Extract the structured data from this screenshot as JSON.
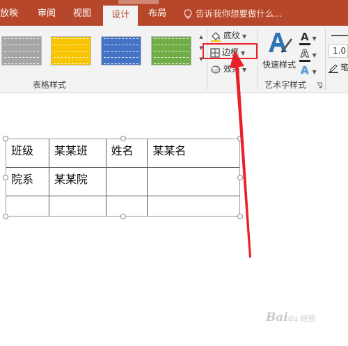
{
  "ribbon_tabs": {
    "slideshow": "放映",
    "review": "审阅",
    "view": "视图",
    "design": "设计",
    "layout": "布局"
  },
  "tell_me": {
    "placeholder": "告诉我你想要做什么..."
  },
  "table_styles": {
    "group_label": "表格样式",
    "swatches": [
      {
        "name": "gray",
        "color": "#a6a6a6"
      },
      {
        "name": "gold",
        "color": "#f6c500"
      },
      {
        "name": "blue",
        "color": "#4472c4"
      },
      {
        "name": "green",
        "color": "#70ad47"
      }
    ]
  },
  "table_format": {
    "shading": "底纹",
    "borders": "边框",
    "effects": "效果"
  },
  "wordart": {
    "quick_styles": "快速样式",
    "group_label": "艺术字样式",
    "text_fill": "A",
    "text_outline": "A",
    "text_effects": "A"
  },
  "draw_borders": {
    "pen_weight": "1.0",
    "pen_label": "笔"
  },
  "table": {
    "rows": [
      [
        "班级",
        "某某班",
        "姓名",
        "某某名"
      ],
      [
        "院系",
        "某某院",
        "",
        ""
      ],
      [
        "",
        "",
        "",
        ""
      ]
    ]
  },
  "annotation_color": "#e8202a",
  "theme_color": "#b7472a",
  "watermark": {
    "main": "Bai",
    "tail": "du 经验"
  }
}
